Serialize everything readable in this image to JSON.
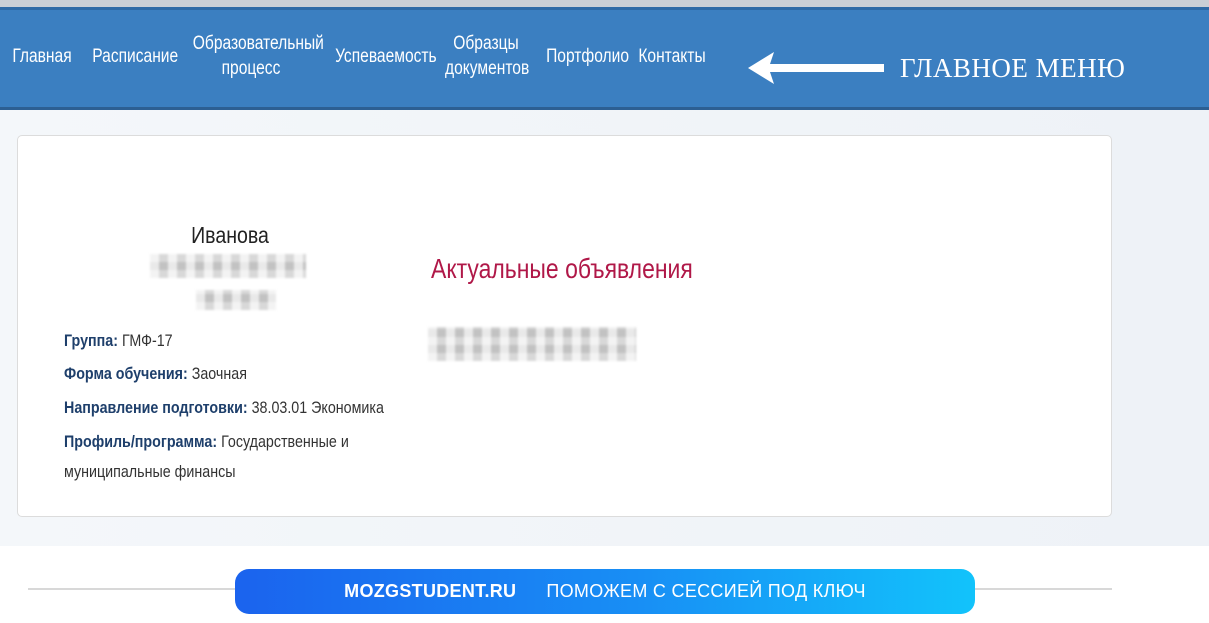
{
  "nav": {
    "items": [
      {
        "label": "Главная"
      },
      {
        "label": "Расписание"
      },
      {
        "label": "Образовательный\nпроцесс"
      },
      {
        "label": "Успеваемость"
      },
      {
        "label": "Образцы\nдокументов"
      },
      {
        "label": "Портфолио"
      },
      {
        "label": "Контакты"
      }
    ],
    "annotation": "ГЛАВНОЕ МЕНЮ",
    "bar_color": "#3b7fc1"
  },
  "profile": {
    "surname": "Иванова",
    "group_label": "Группа:",
    "group_value": "ГМФ-17",
    "study_form_label": "Форма обучения:",
    "study_form_value": "Заочная",
    "direction_label": "Направление подготовки:",
    "direction_value": "38.03.01 Экономика",
    "profile_label": "Профиль/программа:",
    "profile_value_line1": "Государственные и",
    "profile_value_line2": "муниципальные финансы"
  },
  "announcements": {
    "title": "Актуальные объявления",
    "title_color": "#b01848"
  },
  "banner": {
    "brand": "MOZGSTUDENT.RU",
    "tagline": "ПОМОЖЕМ С СЕССИЕЙ ПОД КЛЮЧ"
  },
  "icons": {
    "annotation_arrow": "arrow-left-icon"
  }
}
